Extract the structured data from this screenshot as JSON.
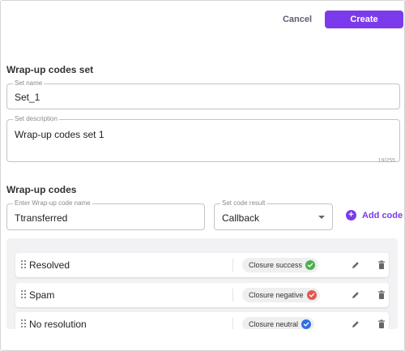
{
  "header": {
    "cancel_label": "Cancel",
    "create_label": "Create"
  },
  "codes_set": {
    "title": "Wrap-up codes set",
    "name_label": "Set name",
    "name_value": "Set_1",
    "description_label": "Set description",
    "description_value": "Wrap-up codes set 1",
    "char_counter": "19/255"
  },
  "codes": {
    "title": "Wrap-up codes",
    "code_name_label": "Enter Wrap-up code name",
    "code_name_value": "Ttransferred",
    "result_label": "Set code result",
    "result_value": "Callback",
    "add_label": "Add code"
  },
  "colors": {
    "accent": "#7c3aed",
    "success": "#4caf50",
    "negative": "#e5574f",
    "neutral": "#2f6fe4"
  },
  "list": [
    {
      "name": "Resolved",
      "result": "Closure success",
      "status": "success",
      "icon": "check-circle-icon"
    },
    {
      "name": "Spam",
      "result": "Closure negative",
      "status": "negative",
      "icon": "check-circle-icon"
    },
    {
      "name": "No resolution",
      "result": "Closure neutral",
      "status": "neutral",
      "icon": "check-circle-icon"
    }
  ]
}
